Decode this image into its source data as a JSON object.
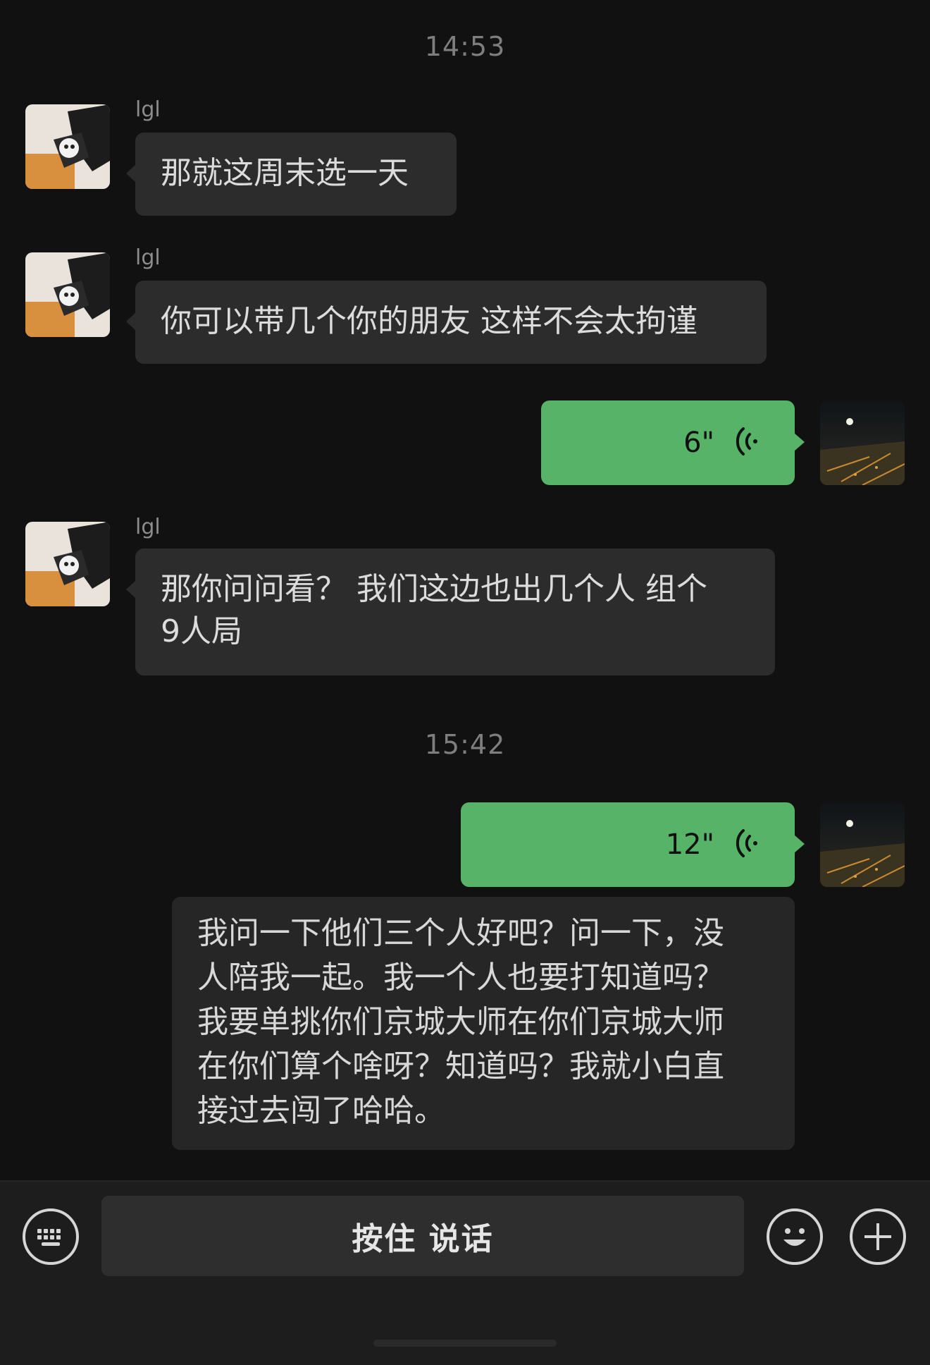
{
  "chat": {
    "timestamps": [
      "14:53",
      "15:42"
    ],
    "messages": [
      {
        "side": "in",
        "sender": "lgl",
        "text": "那就这周末选一天"
      },
      {
        "side": "in",
        "sender": "lgl",
        "text": "你可以带几个你的朋友 这样不会太拘谨"
      },
      {
        "side": "out",
        "type": "voice",
        "duration": "6\""
      },
      {
        "side": "in",
        "sender": "lgl",
        "line1": "那你问问看？ 我们这边也出几个人 组个",
        "line2": "9人局"
      },
      {
        "side": "out",
        "type": "voice",
        "duration": "12\""
      }
    ],
    "transcript": {
      "lines": [
        "我问一下他们三个人好吧？问一下，没",
        "人陪我一起。我一个人也要打知道吗？",
        "我要单挑你们京城大师在你们京城大师",
        "在你们算个啥呀？知道吗？我就小白直",
        "接过去闯了哈哈。"
      ]
    }
  },
  "input_bar": {
    "keyboard_icon": "keyboard-icon",
    "hold_to_talk_label": "按住 说话",
    "emoji_icon": "emoji-icon",
    "plus_icon": "plus-icon"
  },
  "colors": {
    "background": "#111111",
    "incoming_bubble": "#2c2c2c",
    "outgoing_bubble": "#57b368",
    "timestamp": "#7e7e7e"
  }
}
